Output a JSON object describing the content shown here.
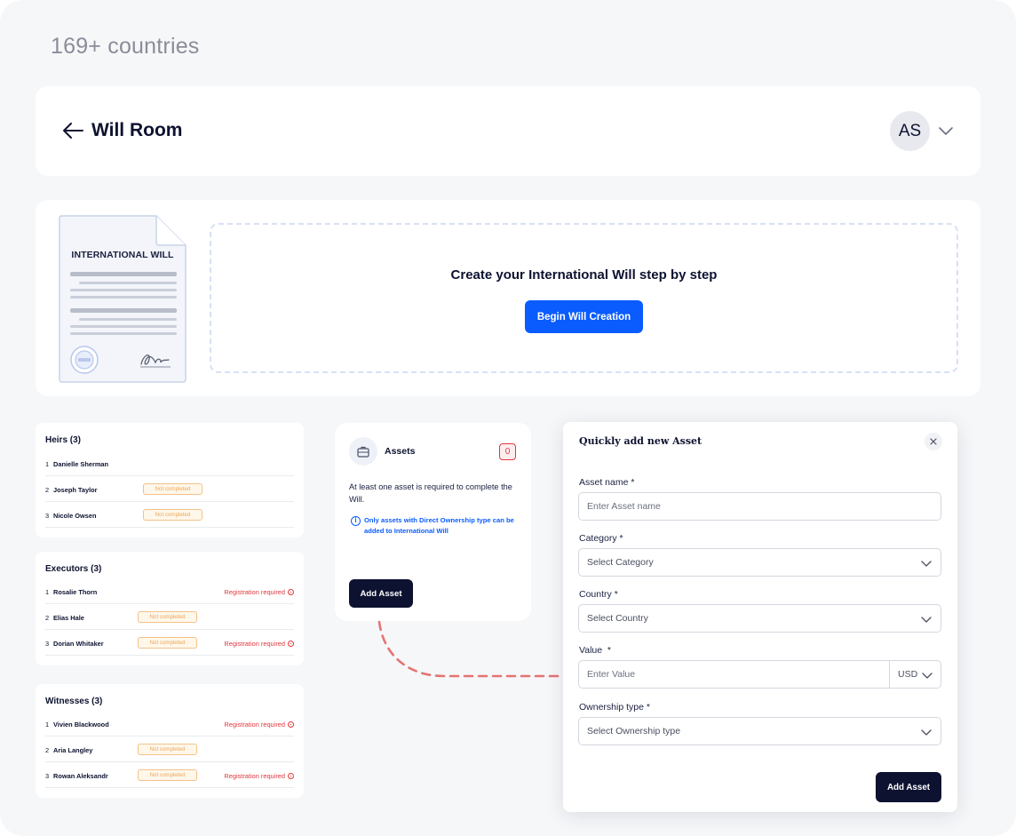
{
  "headline": "169+ countries",
  "header": {
    "title": "Will Room",
    "avatar_initials": "AS"
  },
  "hero": {
    "document_title": "INTERNATIONAL WILL",
    "prompt": "Create your International Will step by step",
    "begin_button": "Begin Will Creation"
  },
  "heirs": {
    "title": "Heirs (3)",
    "rows": [
      {
        "num": "1",
        "name": "Danielle Sherman"
      },
      {
        "num": "2",
        "name": "Joseph Taylor",
        "status": "Not completed"
      },
      {
        "num": "3",
        "name": "Nicole Owsen",
        "status": "Not completed"
      }
    ]
  },
  "executors": {
    "title": "Executors (3)",
    "rows": [
      {
        "num": "1",
        "name": "Rosalie Thorn",
        "registration": "Registration required"
      },
      {
        "num": "2",
        "name": "Elias Hale",
        "status": "Not completed"
      },
      {
        "num": "3",
        "name": "Dorian Whitaker",
        "status": "Not completed",
        "registration": "Registration required"
      }
    ]
  },
  "witnesses": {
    "title": "Witnesses (3)",
    "rows": [
      {
        "num": "1",
        "name": "Vivien Blackwood",
        "registration": "Registration required"
      },
      {
        "num": "2",
        "name": "Aria Langley",
        "status": "Not completed"
      },
      {
        "num": "3",
        "name": "Rowan Aleksandr",
        "status": "Not completed",
        "registration": "Registration required"
      }
    ]
  },
  "assets": {
    "title": "Assets",
    "count": "0",
    "description": "At least one asset is required to complete the Will.",
    "note": "Only assets with Direct Ownership type can be added to International Will",
    "add_button": "Add Asset"
  },
  "quick_add": {
    "title": "Quickly add new Asset",
    "asset_name": {
      "label": "Asset name",
      "placeholder": "Enter Asset name"
    },
    "category": {
      "label": "Category",
      "selected": "Select Category"
    },
    "country": {
      "label": "Country",
      "selected": "Select Country"
    },
    "value": {
      "label": "Value",
      "placeholder": "Enter Value",
      "currency": "USD"
    },
    "ownership_type": {
      "label": "Ownership type",
      "selected": "Select Ownership type"
    },
    "required_marker": "*",
    "submit": "Add Asset"
  },
  "colors": {
    "primary_blue": "#0a5cff",
    "navy": "#0d1230",
    "error_red": "#e0383e",
    "warning_orange": "#e9a860",
    "connector_dash": "#e57373"
  }
}
